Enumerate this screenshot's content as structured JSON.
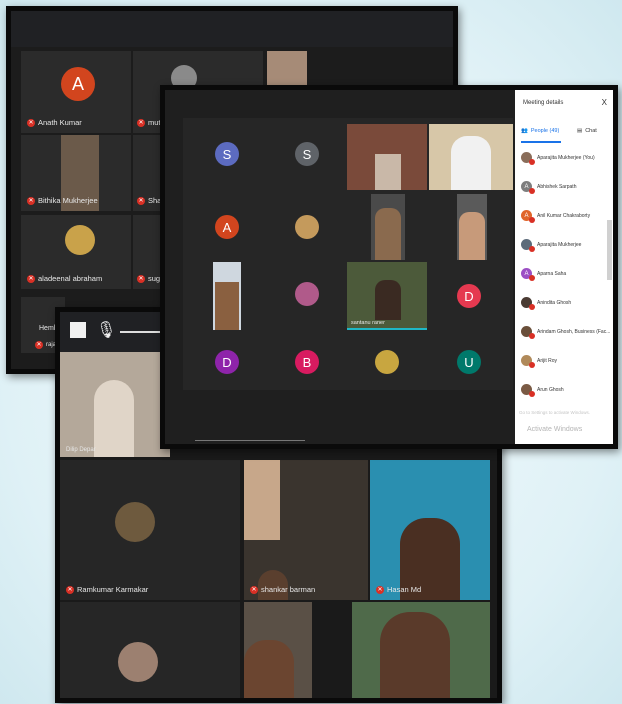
{
  "shot1": {
    "tiles": [
      {
        "name": "Anath Kumar"
      },
      {
        "name": "muthu t"
      },
      {
        "name": "Bithika Mukherjee"
      },
      {
        "name": "Sharmi"
      },
      {
        "name": "aladeenal abraham"
      },
      {
        "name": "suguna"
      },
      {
        "name": "Hemlat"
      },
      {
        "name": "raja"
      }
    ],
    "avatar_letter": "A"
  },
  "shot2": {
    "avatars": [
      "S",
      "S",
      "A",
      "D",
      "B",
      "U",
      "D"
    ],
    "video_name": "santanu raner",
    "panel": {
      "title": "Meeting details",
      "close": "X",
      "tab_people": "People (49)",
      "tab_chat": "Chat",
      "people": [
        {
          "name": "Aparajita Mukherjee (You)",
          "letter": "",
          "color": "#8a6d5a"
        },
        {
          "name": "Abhishek Sarpath",
          "letter": "A",
          "color": "#7e7e7e"
        },
        {
          "name": "Anil Kumar Chakraborty",
          "letter": "A",
          "color": "#e0652a"
        },
        {
          "name": "Aparajita Mukherjee",
          "letter": "",
          "color": "#5c6b7a"
        },
        {
          "name": "Aparna Saha",
          "letter": "A",
          "color": "#9c4fc4"
        },
        {
          "name": "Anindita Ghosh",
          "letter": "",
          "color": "#4a3b33"
        },
        {
          "name": "Arindam Ghosh, Business (Fac...",
          "letter": "",
          "color": "#6a4f3a"
        },
        {
          "name": "Arijit Roy",
          "letter": "",
          "color": "#b08a5a"
        },
        {
          "name": "Arun Ghosh",
          "letter": "",
          "color": "#7a5a44"
        }
      ],
      "watermark": "Activate Windows",
      "watermark_sub": "Go to Settings to activate Windows."
    }
  },
  "shot3": {
    "tiles": [
      {
        "name": "Dilip Depar"
      },
      {
        "name": "Ramkumar Karmakar"
      },
      {
        "name": "shankar barman"
      },
      {
        "name": "Hasan Md"
      }
    ]
  },
  "colors": {
    "frame": "#0a0a0a",
    "meet_bg": "#1f1f1f",
    "tile_bg": "#2b2b2b",
    "mic_red": "#d93025",
    "avatar_orange": "#d2451e",
    "avatar_indigo": "#5c6bc0",
    "avatar_gray": "#5f6368",
    "avatar_purple": "#8e24aa",
    "avatar_pink": "#d81b60",
    "avatar_teal": "#00796b",
    "avatar_red": "#e53950"
  },
  "icons": [
    "mic-muted-icon",
    "stop-icon",
    "microphone-icon",
    "people-icon",
    "chat-icon",
    "close-icon"
  ]
}
